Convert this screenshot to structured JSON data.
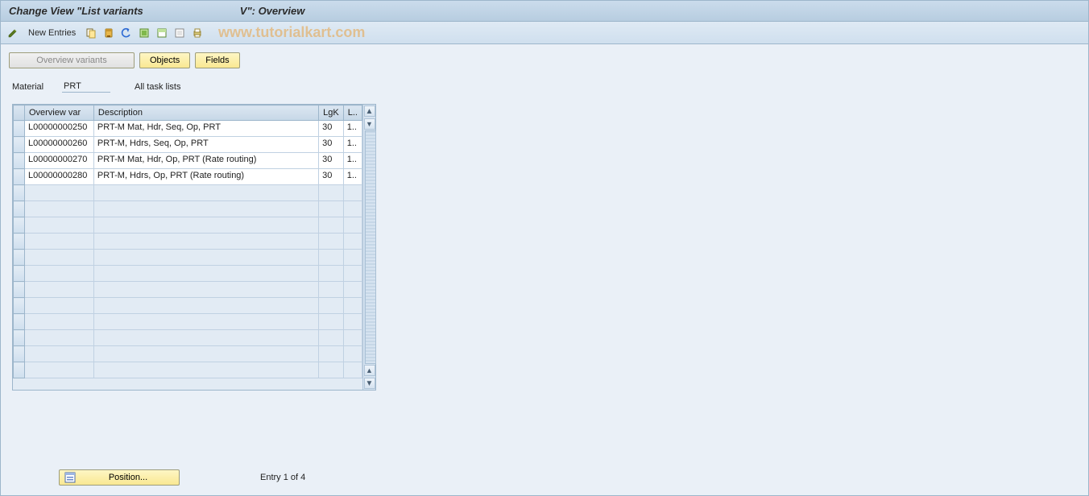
{
  "title": {
    "part1": "Change View \"List variants",
    "part2": "V\": Overview"
  },
  "toolbar": {
    "new_entries": "New Entries"
  },
  "watermark": "www.tutorialkart.com",
  "tabs": {
    "overview_variants": "Overview variants",
    "objects": "Objects",
    "fields": "Fields"
  },
  "info": {
    "label": "Material",
    "value": "PRT",
    "scope": "All task lists"
  },
  "table": {
    "headers": {
      "overview_var": "Overview var",
      "description": "Description",
      "lgk": "LgK",
      "l": "L.."
    },
    "rows": [
      {
        "ov": "L00000000250",
        "desc": "PRT-M Mat, Hdr, Seq, Op, PRT",
        "lgk": "30",
        "l": "1.."
      },
      {
        "ov": "L00000000260",
        "desc": "PRT-M, Hdrs, Seq, Op, PRT",
        "lgk": "30",
        "l": "1.."
      },
      {
        "ov": "L00000000270",
        "desc": "PRT-M Mat, Hdr, Op, PRT (Rate routing)",
        "lgk": "30",
        "l": "1.."
      },
      {
        "ov": "L00000000280",
        "desc": "PRT-M, Hdrs, Op, PRT (Rate routing)",
        "lgk": "30",
        "l": "1.."
      }
    ],
    "empty_rows": 12
  },
  "footer": {
    "position_button": "Position...",
    "entry_text": "Entry 1 of 4"
  }
}
